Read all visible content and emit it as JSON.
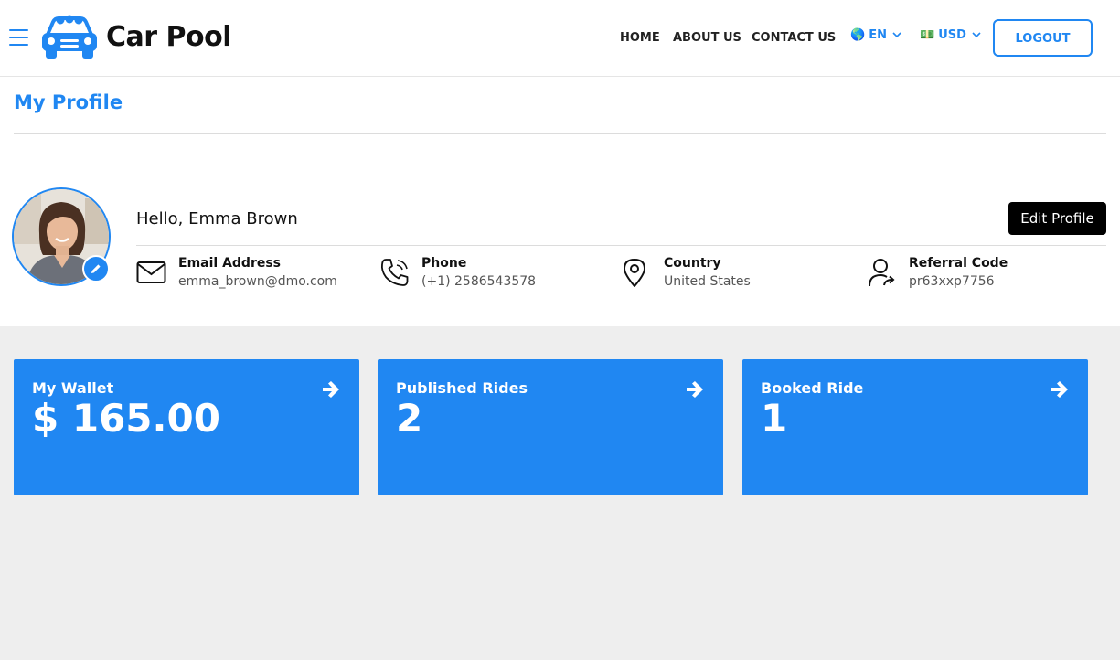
{
  "header": {
    "brand": "Car Pool",
    "nav": [
      {
        "label": "HOME"
      },
      {
        "label": "ABOUT US"
      },
      {
        "label": "CONTACT US"
      }
    ],
    "language": {
      "flag": "🌎",
      "label": "EN"
    },
    "currency": {
      "flag": "💵",
      "label": "USD"
    },
    "logout_label": "LOGOUT"
  },
  "profile": {
    "page_title": "My Profile",
    "greeting": "Hello, Emma Brown",
    "edit_label": "Edit Profile",
    "info": [
      {
        "label": "Email Address",
        "value": "emma_brown@dmo.com",
        "icon": "envelope-icon"
      },
      {
        "label": "Phone",
        "value": "(+1) 2586543578",
        "icon": "phone-icon"
      },
      {
        "label": "Country",
        "value": "United States",
        "icon": "location-pin-icon"
      },
      {
        "label": "Referral Code",
        "value": "pr63xxp7756",
        "icon": "user-share-icon"
      }
    ]
  },
  "cards": [
    {
      "label": "My Wallet",
      "value": "$ 165.00"
    },
    {
      "label": "Published Rides",
      "value": "2"
    },
    {
      "label": "Booked Ride",
      "value": "1"
    }
  ],
  "colors": {
    "accent": "#2087f2",
    "background": "#eeeeee",
    "dark_button": "#000000"
  }
}
